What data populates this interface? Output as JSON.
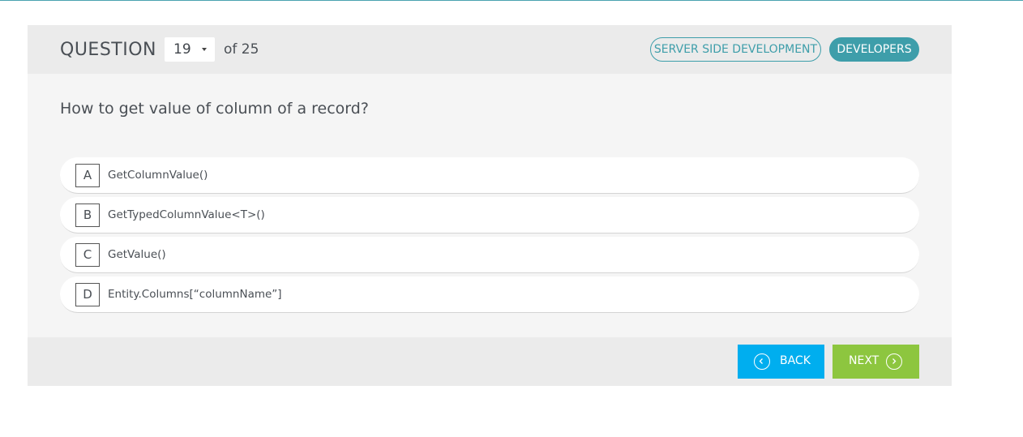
{
  "header": {
    "question_label": "QUESTION",
    "current_question": "19",
    "of_total": "of 25",
    "tags": [
      "SERVER SIDE DEVELOPMENT",
      "DEVELOPERS"
    ]
  },
  "question": {
    "text": "How to get value of column of a record?"
  },
  "answers": [
    {
      "letter": "A",
      "text": "GetColumnValue()"
    },
    {
      "letter": "B",
      "text": "GetTypedColumnValue<T>()"
    },
    {
      "letter": "C",
      "text": "GetValue()"
    },
    {
      "letter": "D",
      "text": "Entity.Columns[“columnName”]"
    }
  ],
  "footer": {
    "back_label": "BACK",
    "next_label": "NEXT"
  },
  "icons": {
    "back": "chevron-left-circle-icon",
    "next": "chevron-right-circle-icon",
    "select": "caret-down-icon"
  },
  "colors": {
    "accent": "#3e9eaa",
    "back_button": "#00aeef",
    "next_button": "#8dc63f"
  }
}
